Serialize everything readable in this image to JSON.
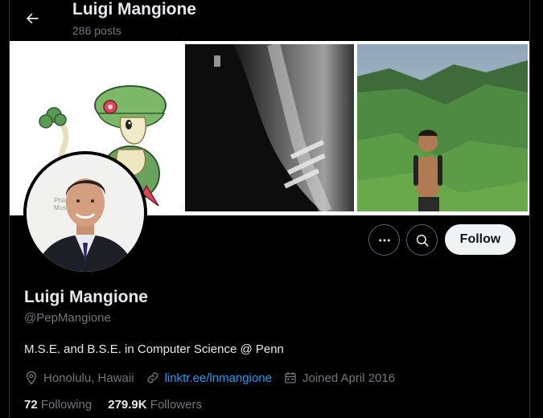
{
  "header": {
    "title": "Luigi Mangione",
    "posts": "286 posts"
  },
  "banner": {
    "panels": [
      "pokemon-illustration",
      "spine-xray",
      "hiking-photo"
    ]
  },
  "avatar": {
    "caption_line1": "Philad",
    "caption_line2": "Muse"
  },
  "actions": {
    "follow_label": "Follow"
  },
  "profile": {
    "display_name": "Luigi Mangione",
    "handle": "@PepMangione",
    "bio": "M.S.E. and B.S.E. in Computer Science @ Penn",
    "location": "Honolulu, Hawaii",
    "link": "linktr.ee/lnmangione",
    "joined": "Joined April 2016"
  },
  "stats": {
    "following_count": "72",
    "following_label": "Following",
    "followers_count": "279.9K",
    "followers_label": "Followers"
  },
  "colors": {
    "background": "#000000",
    "text": "#e7e9ea",
    "muted": "#71767b",
    "link": "#1d9bf0",
    "follow_bg": "#eff3f4"
  }
}
